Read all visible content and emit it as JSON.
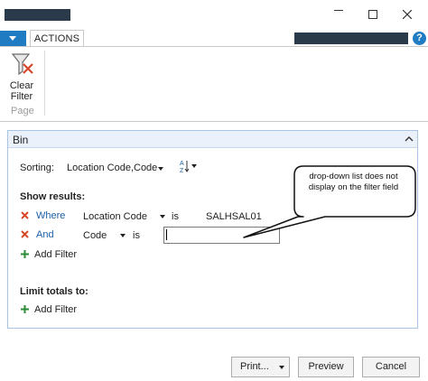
{
  "window": {
    "minimize_glyph": "—",
    "close_glyph": "✕"
  },
  "ribbon": {
    "tab_actions": "ACTIONS",
    "clear_filter_line1": "Clear",
    "clear_filter_line2": "Filter",
    "group_page": "Page",
    "accent_color": "#1f7cc3"
  },
  "panel": {
    "title": "Bin",
    "sorting_label": "Sorting:",
    "sorting_value": "Location Code,Code",
    "show_results_label": "Show results:",
    "filters": [
      {
        "connector": "Where",
        "field": "Location Code",
        "operator": "is",
        "value": "SALHSAL01"
      },
      {
        "connector": "And",
        "field": "Code",
        "operator": "is",
        "value": ""
      }
    ],
    "add_filter_label": "Add Filter",
    "limit_totals_label": "Limit totals to:",
    "add_filter_label_2": "Add Filter"
  },
  "callout": {
    "text": "drop-down list does not display on the filter field"
  },
  "buttons": {
    "print": "Print...",
    "preview": "Preview",
    "cancel": "Cancel"
  },
  "icons": {
    "filter_clear": "filter-clear-icon",
    "remove": "x-icon",
    "add": "plus-icon",
    "sort": "sort-az-icon",
    "help": "help-icon"
  }
}
